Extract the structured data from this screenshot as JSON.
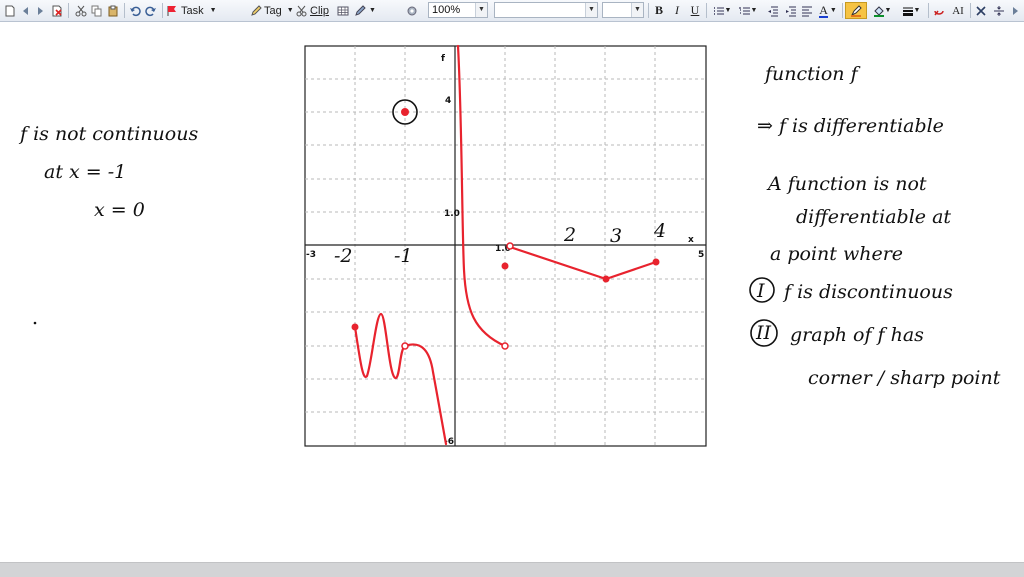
{
  "toolbar": {
    "task_label": "Task",
    "tag_label": "Tag",
    "clip_label": "Clip",
    "zoom_value": "100%",
    "style_value": "",
    "size_value": "",
    "bold_label": "B",
    "italic_label": "I",
    "underline_label": "U",
    "font_color_label": "A",
    "font_label": "AI"
  },
  "graph": {
    "y_axis_label": "f",
    "x_axis_label": "x",
    "ticks": {
      "x_min": "-3",
      "x_max": "5",
      "y_max": "4",
      "y_one": "1.0",
      "y_min": "-6",
      "x_one": "1.0"
    }
  },
  "notes": {
    "left_line1": "f is not continuous",
    "left_line2": "at  x = -1",
    "left_line3": "x = 0",
    "graph_x_labels": [
      "-2",
      "-1",
      "2",
      "3",
      "4"
    ],
    "right_line1": "function f",
    "right_line2": "⇒ f is differentiable",
    "right_line3": "A function is not",
    "right_line4": "differentiable at",
    "right_line5": "a  point  where",
    "right_line6": "f  is  discontinuous",
    "right_line7": "graph of  f  has",
    "right_line8": "corner / sharp point",
    "num_1": "I",
    "num_2": "II"
  },
  "colors": {
    "curve": "#e8232e",
    "ink": "#111111",
    "grid": "#b8b8b8"
  }
}
